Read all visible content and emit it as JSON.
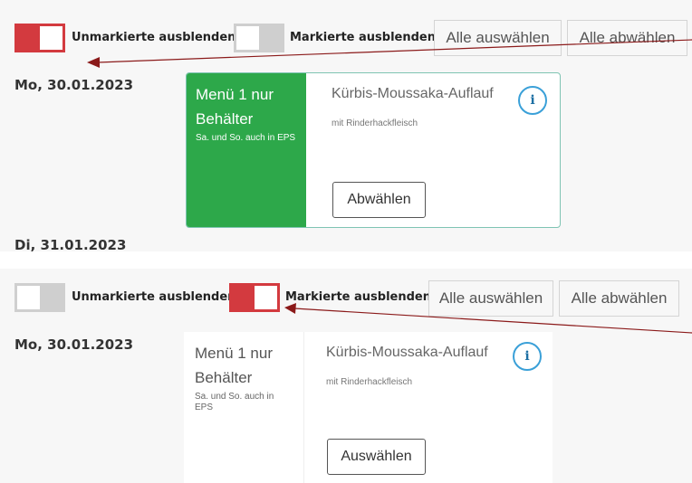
{
  "top": {
    "toggle_unmarked": {
      "label": "Unmarkierte ausblenden",
      "state": "on"
    },
    "toggle_marked": {
      "label": "Markierte ausblenden",
      "state": "off"
    },
    "select_all": "Alle auswählen",
    "deselect_all": "Alle abwählen",
    "day1": {
      "date": "Mo, 30.01.2023",
      "menu": {
        "title": "Menü 1 nur Behälter",
        "note": "Sa. und So. auch in EPS",
        "dish": "Kürbis-Moussaka-Auflauf",
        "dish_sub": "mit Rinderhackfleisch",
        "info": "i",
        "action": "Abwählen",
        "selected": true
      }
    },
    "day2_date": "Di, 31.01.2023"
  },
  "bottom": {
    "toggle_unmarked": {
      "label": "Unmarkierte ausblenden",
      "state": "off"
    },
    "toggle_marked": {
      "label": "Markierte ausblenden",
      "state": "on"
    },
    "select_all": "Alle auswählen",
    "deselect_all": "Alle abwählen",
    "day1": {
      "date": "Mo, 30.01.2023",
      "menu": {
        "title": "Menü 1 nur Behälter",
        "note": "Sa. und So. auch in EPS",
        "dish": "Kürbis-Moussaka-Auflauf",
        "dish_sub": "mit Rinderhackfleisch",
        "info": "i",
        "action": "Auswählen",
        "selected": false
      }
    }
  },
  "colors": {
    "toggle_on": "#d33a3f",
    "toggle_off": "#cfcfcf",
    "selected_menu": "#2da84a",
    "info_icon": "#3aa0d8",
    "annotation_arrow": "#8b1a1a"
  },
  "icons": [
    "info-icon",
    "annotation-arrow"
  ]
}
